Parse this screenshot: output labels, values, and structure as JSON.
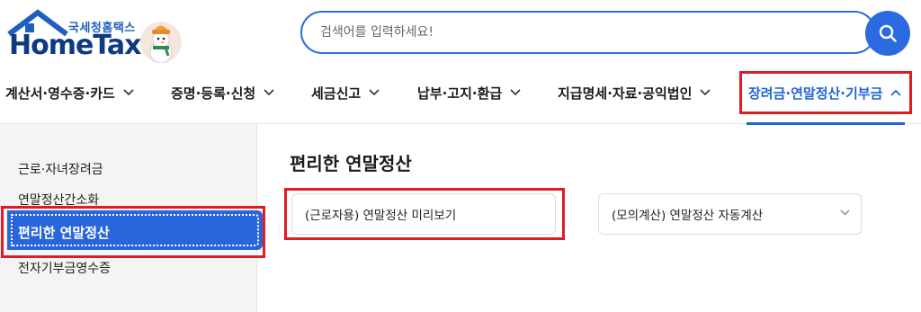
{
  "header": {
    "logo_sub": "국세청홈택스",
    "logo_main": "HomeTax",
    "search_placeholder": "검색어를 입력하세요!"
  },
  "nav": {
    "items": [
      {
        "label": "계산서·영수증·카드"
      },
      {
        "label": "증명·등록·신청"
      },
      {
        "label": "세금신고"
      },
      {
        "label": "납부·고지·환급"
      },
      {
        "label": "지급명세·자료·공익법인"
      },
      {
        "label": "장려금·연말정산·기부금",
        "active": true
      }
    ]
  },
  "sidebar": {
    "items": [
      {
        "label": "근로·자녀장려금"
      },
      {
        "label": "연말정산간소화"
      },
      {
        "label": "편리한 연말정산",
        "active": true
      },
      {
        "label": "전자기부금영수증"
      }
    ]
  },
  "main": {
    "title": "편리한 연말정산",
    "cards": [
      {
        "label": "(근로자용) 연말정산 미리보기"
      },
      {
        "label": "(모의계산) 연말정산 자동계산"
      }
    ]
  },
  "colors": {
    "accent": "#2063d6",
    "highlight": "#e11b24",
    "logo": "#0e3a82"
  }
}
